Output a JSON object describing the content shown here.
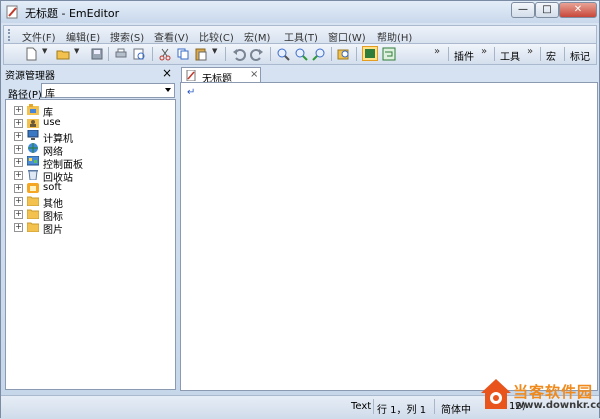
{
  "window": {
    "title": "无标题 - EmEditor",
    "min": "—",
    "max": "□",
    "close": "✕"
  },
  "menu": [
    "文件(F)",
    "编辑(E)",
    "搜索(S)",
    "查看(V)",
    "比较(C)",
    "宏(M)",
    "工具(T)",
    "窗口(W)",
    "帮助(H)"
  ],
  "toolbar": {
    "plugins": "插件",
    "tools": "工具",
    "macros": "宏",
    "marks": "标记",
    "more": "»"
  },
  "explorer": {
    "title": "资源管理器",
    "close": "×",
    "path_label": "路径(P):",
    "path_value": "库",
    "expander": "+",
    "items": [
      {
        "label": "库",
        "icon": "library-icon"
      },
      {
        "label": "use",
        "icon": "user-icon"
      },
      {
        "label": "计算机",
        "icon": "computer-icon"
      },
      {
        "label": "网络",
        "icon": "network-icon"
      },
      {
        "label": "控制面板",
        "icon": "control-panel-icon"
      },
      {
        "label": "回收站",
        "icon": "recycle-bin-icon"
      },
      {
        "label": "soft",
        "icon": "folder-icon"
      },
      {
        "label": "其他",
        "icon": "folder-icon"
      },
      {
        "label": "图标",
        "icon": "folder-icon"
      },
      {
        "label": "图片",
        "icon": "folder-icon"
      }
    ]
  },
  "editor": {
    "tab_label": "无标题",
    "tab_close": "×",
    "eol": "↵"
  },
  "status": {
    "mode": "Text",
    "position": "行 1，列 1",
    "encoding": "简体中",
    "encoding_tail": "12)"
  },
  "watermark": {
    "site": "当客软件园",
    "url": "www.downkr.com"
  },
  "colors": {
    "accent": "#2a56c6",
    "watermark": "#f08a1c"
  }
}
